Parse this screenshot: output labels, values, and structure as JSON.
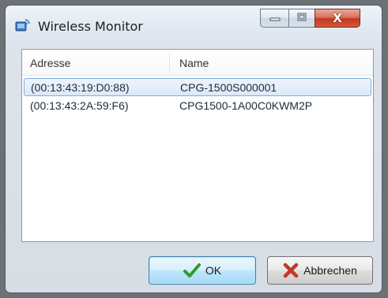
{
  "window": {
    "title": "Wireless Monitor"
  },
  "window_controls": {
    "minimize_icon": "minimize-icon",
    "maximize_icon": "maximize-icon",
    "close_label": "X"
  },
  "list": {
    "columns": [
      "Adresse",
      "Name"
    ],
    "rows": [
      {
        "address": "(00:13:43:19:D0:88)",
        "name": "CPG-1500S000001",
        "selected": true
      },
      {
        "address": "(00:13:43:2A:59:F6)",
        "name": "CPG1500-1A00C0KWM2P",
        "selected": false
      }
    ]
  },
  "buttons": {
    "ok_label": "OK",
    "ok_icon": "checkmark-icon",
    "cancel_label": "Abbrechen",
    "cancel_icon": "red-x-icon"
  },
  "colors": {
    "selection_border": "#84acdd",
    "ok_check": "#2e9a2e",
    "cancel_x": "#c0392b"
  }
}
